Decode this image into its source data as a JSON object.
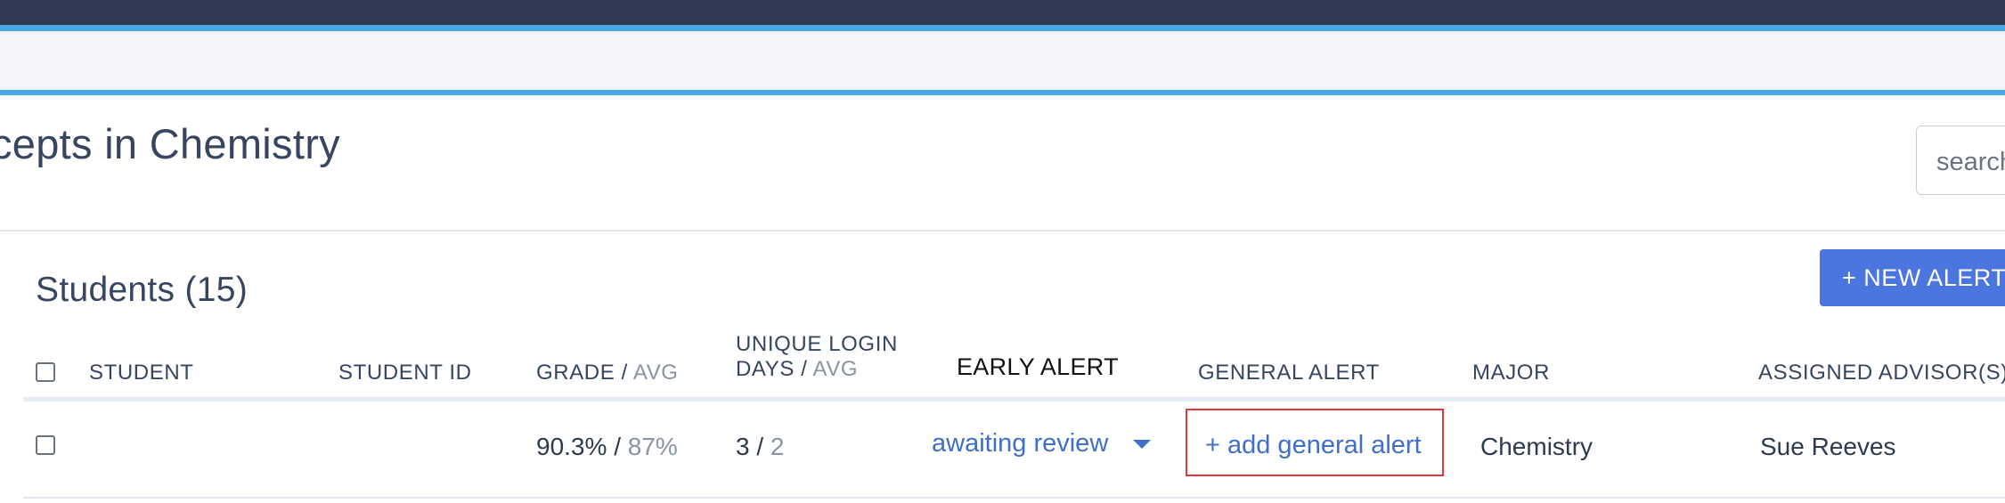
{
  "course": {
    "title": "cepts in Chemistry"
  },
  "search": {
    "placeholder": "search"
  },
  "students": {
    "title": "Students (15)",
    "new_alert_label": "+ NEW ALERT"
  },
  "table": {
    "headers": {
      "student": "STUDENT",
      "student_id": "STUDENT ID",
      "grade": "GRADE",
      "grade_avg": "AVG",
      "login_line1": "UNIQUE LOGIN",
      "login_line2": "DAYS",
      "login_avg": "AVG",
      "early_alert": "EARLY ALERT",
      "general_alert": "GENERAL ALERT",
      "major": "MAJOR",
      "advisor": "ASSIGNED ADVISOR(S)",
      "separator": "/"
    },
    "rows": [
      {
        "grade": "90.3%",
        "grade_avg": "87%",
        "login_days": "3",
        "login_avg": "2",
        "early_alert_status": "awaiting review",
        "general_alert_action": "+ add general alert",
        "major": "Chemistry",
        "advisor": "Sue Reeves"
      }
    ]
  },
  "colors": {
    "top_bar": "#313a52",
    "accent": "#4aa8e6",
    "button": "#4b76df",
    "link": "#3f6fc8",
    "highlight": "#e0383b"
  }
}
